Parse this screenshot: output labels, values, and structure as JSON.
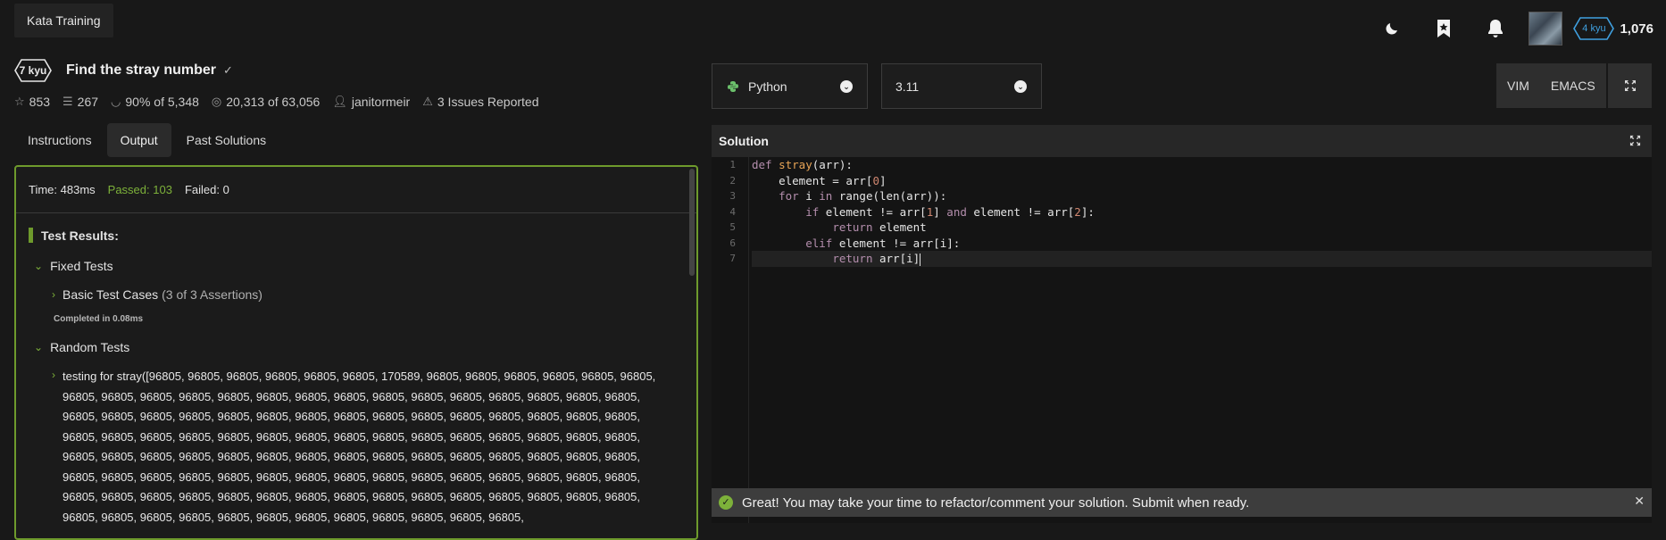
{
  "topbar": {
    "kata_training": "Kata Training",
    "rank": "4 kyu",
    "honor": "1,076"
  },
  "kata": {
    "rank": "7 kyu",
    "title": "Find the stray number",
    "stats": {
      "stars": "853",
      "collections": "267",
      "satisfaction": "90% of 5,348",
      "completed": "20,313 of 63,056",
      "author": "janitormeir",
      "issues": "3 Issues Reported"
    }
  },
  "tabs": [
    "Instructions",
    "Output",
    "Past Solutions"
  ],
  "output": {
    "time": "Time: 483ms",
    "passed": "Passed: 103",
    "failed": "Failed: 0",
    "results_title": "Test Results:",
    "fixed_tests": "Fixed Tests",
    "basic_cases": "Basic Test Cases",
    "basic_assertions": "(3 of 3 Assertions)",
    "completed_in": "Completed in 0.08ms",
    "random_tests": "Random Tests",
    "random_case": "testing for stray([96805, 96805, 96805, 96805, 96805, 96805, 170589, 96805, 96805, 96805, 96805, 96805, 96805, 96805, 96805, 96805, 96805, 96805, 96805, 96805, 96805, 96805, 96805, 96805, 96805, 96805, 96805, 96805, 96805, 96805, 96805, 96805, 96805, 96805, 96805, 96805, 96805, 96805, 96805, 96805, 96805, 96805, 96805, 96805, 96805, 96805, 96805, 96805, 96805, 96805, 96805, 96805, 96805, 96805, 96805, 96805, 96805, 96805, 96805, 96805, 96805, 96805, 96805, 96805, 96805, 96805, 96805, 96805, 96805, 96805, 96805, 96805, 96805, 96805, 96805, 96805, 96805, 96805, 96805, 96805, 96805, 96805, 96805, 96805, 96805, 96805, 96805, 96805, 96805, 96805, 96805, 96805, 96805, 96805, 96805, 96805, 96805, 96805, 96805, 96805, 96805, 96805, 96805, 96805, 96805, 96805, 96805, 96805, 96805, 96805, 96805, 96805, 96805, 96805, 96805,"
  },
  "editor_bar": {
    "language": "Python",
    "version": "3.11",
    "vim": "VIM",
    "emacs": "EMACS"
  },
  "solution": {
    "title": "Solution",
    "line_numbers": [
      "1",
      "2",
      "3",
      "4",
      "5",
      "6",
      "7"
    ],
    "code_lines": [
      "def stray(arr):",
      "    element = arr[0]",
      "    for i in range(len(arr)):",
      "        if element != arr[1] and element != arr[2]:",
      "            return element",
      "        elif element != arr[i]:",
      "            return arr[i]"
    ]
  },
  "toast": {
    "message": "Great! You may take your time to refactor/comment your solution. Submit when ready."
  }
}
